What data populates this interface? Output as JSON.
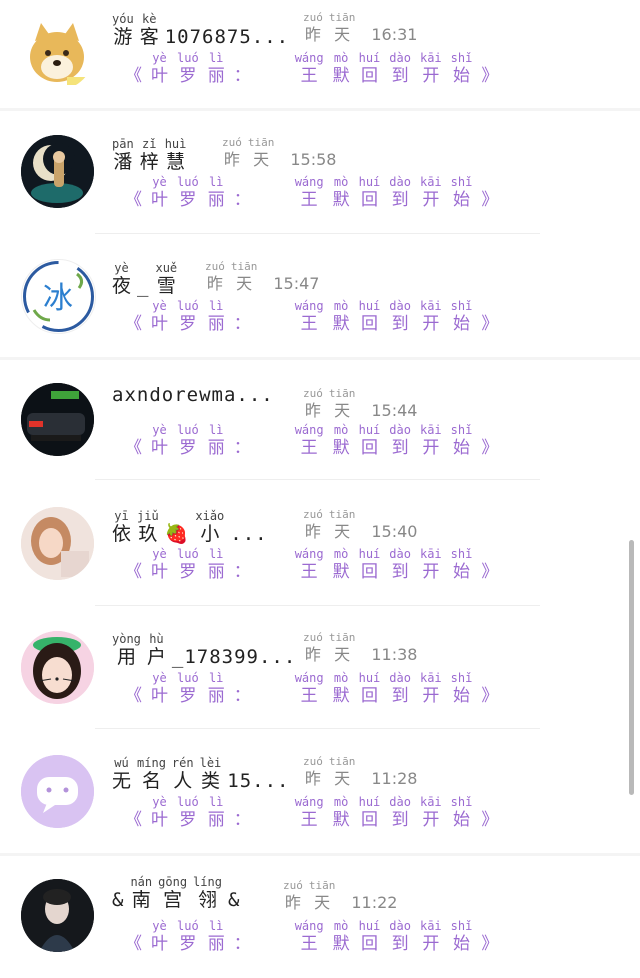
{
  "message_preview": {
    "open_bracket": "《",
    "close_bracket": "》",
    "sender": [
      {
        "py": "yè",
        "hz": "叶"
      },
      {
        "py": "luó",
        "hz": "罗"
      },
      {
        "py": "lì",
        "hz": "丽"
      },
      {
        "py": "",
        "hz": "："
      }
    ],
    "text": [
      {
        "py": "wáng",
        "hz": "王"
      },
      {
        "py": "mò",
        "hz": "默"
      },
      {
        "py": "huí",
        "hz": "回"
      },
      {
        "py": "dào",
        "hz": "到"
      },
      {
        "py": "kāi",
        "hz": "开"
      },
      {
        "py": "shǐ",
        "hz": "始"
      }
    ]
  },
  "timestamp_word": [
    {
      "py": "zuó",
      "hz": "昨"
    },
    {
      "py": "tiān",
      "hz": "天"
    }
  ],
  "chats": [
    {
      "name_parts": [
        {
          "py": "yóu",
          "hz": "游"
        },
        {
          "py": "kè",
          "hz": "客"
        },
        {
          "plain": "1076875..."
        }
      ],
      "time": "16:31",
      "avatar": "doge-avatar"
    },
    {
      "name_parts": [
        {
          "py": "pān",
          "hz": "潘"
        },
        {
          "py": "zǐ",
          "hz": "梓"
        },
        {
          "py": "huì",
          "hz": "慧"
        }
      ],
      "time": "15:58",
      "avatar": "moon-avatar"
    },
    {
      "name_parts": [
        {
          "py": "yè",
          "hz": "夜"
        },
        {
          "plain": "_"
        },
        {
          "py": "xuě",
          "hz": "雪"
        }
      ],
      "time": "15:47",
      "avatar": "ice-avatar"
    },
    {
      "name_parts": [
        {
          "plain": "axndorewma..."
        }
      ],
      "time": "15:44",
      "avatar": "car-avatar"
    },
    {
      "name_parts": [
        {
          "py": "yī",
          "hz": "依"
        },
        {
          "py": "jiǔ",
          "hz": "玖"
        },
        {
          "plain": "🍓"
        },
        {
          "py": "xiǎo",
          "hz": "小"
        },
        {
          "plain": "..."
        }
      ],
      "time": "15:40",
      "avatar": "girl-avatar"
    },
    {
      "name_parts": [
        {
          "py": "yòng",
          "hz": "用"
        },
        {
          "py": "hù",
          "hz": "户"
        },
        {
          "plain": "_178399..."
        }
      ],
      "time": "11:38",
      "avatar": "cat-filter-avatar"
    },
    {
      "name_parts": [
        {
          "py": "wú",
          "hz": "无"
        },
        {
          "py": "míng",
          "hz": "名"
        },
        {
          "py": "rén",
          "hz": "人"
        },
        {
          "py": "lèi",
          "hz": "类"
        },
        {
          "plain": "15..."
        }
      ],
      "time": "11:28",
      "avatar": "chat-bubble-avatar"
    },
    {
      "name_parts": [
        {
          "plain": "&"
        },
        {
          "py": "nán",
          "hz": "南"
        },
        {
          "py": "gōng",
          "hz": "宫"
        },
        {
          "py": "líng",
          "hz": "翎"
        },
        {
          "plain": "&"
        }
      ],
      "time": "11:22",
      "avatar": "portrait-avatar"
    }
  ],
  "colors": {
    "accent_purple": "#9b6ad1",
    "avatar_lavender": "#d9c3f2"
  }
}
